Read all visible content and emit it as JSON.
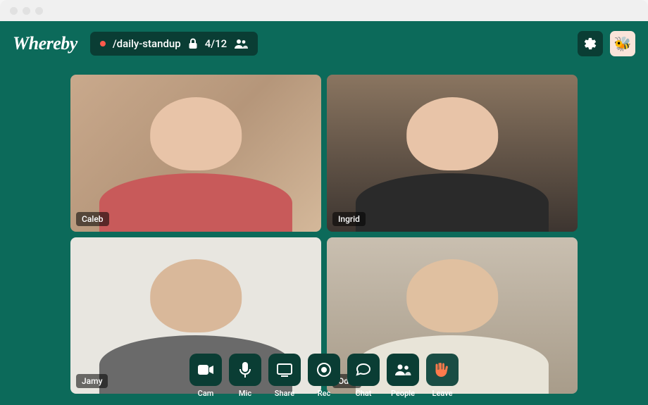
{
  "brand": "Whereby",
  "room": {
    "name": "/daily-standup",
    "participant_count": "4/12"
  },
  "participants": [
    {
      "name": "Caleb"
    },
    {
      "name": "Ingrid"
    },
    {
      "name": "Jamy"
    },
    {
      "name": "Odin"
    }
  ],
  "toolbar": {
    "cam": "Cam",
    "mic": "Mic",
    "share": "Share",
    "rec": "Rec",
    "chat": "Chat",
    "people": "People",
    "leave": "Leave"
  },
  "colors": {
    "background": "#0c6a5a",
    "panel": "#0a3d34",
    "accent_leave": "#ff7a4c"
  }
}
